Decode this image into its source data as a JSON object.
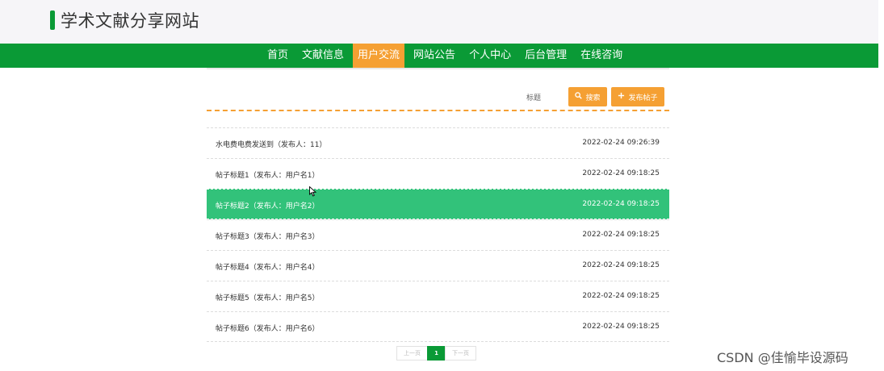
{
  "header": {
    "title": "学术文献分享网站"
  },
  "nav": {
    "items": [
      {
        "label": "首页"
      },
      {
        "label": "文献信息"
      },
      {
        "label": "用户交流"
      },
      {
        "label": "网站公告"
      },
      {
        "label": "个人中心"
      },
      {
        "label": "后台管理"
      },
      {
        "label": "在线咨询"
      }
    ],
    "active_index": 2
  },
  "search": {
    "label": "标题",
    "search_button": "搜索",
    "publish_button": "发布帖子"
  },
  "posts": [
    {
      "title": "水电费电费发送到（发布人：11）",
      "date": "2022-02-24 09:26:39"
    },
    {
      "title": "帖子标题1（发布人：用户名1）",
      "date": "2022-02-24 09:18:25"
    },
    {
      "title": "帖子标题2（发布人：用户名2）",
      "date": "2022-02-24 09:18:25"
    },
    {
      "title": "帖子标题3（发布人：用户名3）",
      "date": "2022-02-24 09:18:25"
    },
    {
      "title": "帖子标题4（发布人：用户名4）",
      "date": "2022-02-24 09:18:25"
    },
    {
      "title": "帖子标题5（发布人：用户名5）",
      "date": "2022-02-24 09:18:25"
    },
    {
      "title": "帖子标题6（发布人：用户名6）",
      "date": "2022-02-24 09:18:25"
    }
  ],
  "highlighted_post_index": 2,
  "pagination": {
    "prev": "上一页",
    "current": "1",
    "next": "下一页"
  },
  "watermark": "CSDN @佳愉毕设源码",
  "colors": {
    "brand_green": "#0a9a36",
    "accent_orange": "#f5a033",
    "highlight_green": "#32c27a"
  }
}
